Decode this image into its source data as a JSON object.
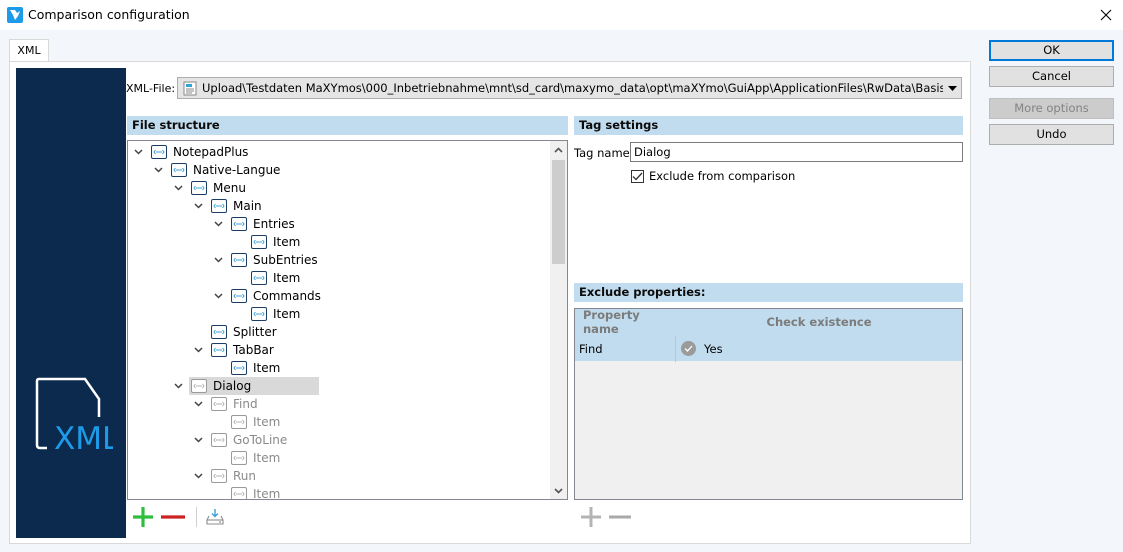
{
  "window": {
    "title": "Comparison configuration",
    "app_icon": "maxymos-app-icon",
    "close_icon": "close-icon"
  },
  "tabs": [
    {
      "label": "XML",
      "active": true
    }
  ],
  "banner": {
    "logo_text": "XML",
    "logo_icon": "xml-file-icon",
    "background": "#0c2a4e",
    "accent": "#1e9be8"
  },
  "xml_file": {
    "label": "XML-File:",
    "value": "Upload\\Testdaten MaXYmos\\000_Inbetriebnahme\\mnt\\sd_card\\maxymo_data\\opt\\maXYmo\\GuiApp\\ApplicationFiles\\RwData\\Basisversion.xml"
  },
  "file_structure": {
    "header": "File structure",
    "nodes": [
      {
        "label": "NotepadPlus",
        "level": 0,
        "expanded": true,
        "dim": false,
        "selected": false
      },
      {
        "label": "Native-Langue",
        "level": 1,
        "expanded": true,
        "dim": false,
        "selected": false
      },
      {
        "label": "Menu",
        "level": 2,
        "expanded": true,
        "dim": false,
        "selected": false
      },
      {
        "label": "Main",
        "level": 3,
        "expanded": true,
        "dim": false,
        "selected": false
      },
      {
        "label": "Entries",
        "level": 4,
        "expanded": true,
        "dim": false,
        "selected": false
      },
      {
        "label": "Item",
        "level": 5,
        "expanded": null,
        "dim": false,
        "selected": false
      },
      {
        "label": "SubEntries",
        "level": 4,
        "expanded": true,
        "dim": false,
        "selected": false
      },
      {
        "label": "Item",
        "level": 5,
        "expanded": null,
        "dim": false,
        "selected": false
      },
      {
        "label": "Commands",
        "level": 4,
        "expanded": true,
        "dim": false,
        "selected": false
      },
      {
        "label": "Item",
        "level": 5,
        "expanded": null,
        "dim": false,
        "selected": false
      },
      {
        "label": "Splitter",
        "level": 3,
        "expanded": null,
        "dim": false,
        "selected": false
      },
      {
        "label": "TabBar",
        "level": 3,
        "expanded": true,
        "dim": false,
        "selected": false
      },
      {
        "label": "Item",
        "level": 4,
        "expanded": null,
        "dim": false,
        "selected": false
      },
      {
        "label": "Dialog",
        "level": 2,
        "expanded": true,
        "dim": false,
        "selected": true
      },
      {
        "label": "Find",
        "level": 3,
        "expanded": true,
        "dim": true,
        "selected": false
      },
      {
        "label": "Item",
        "level": 4,
        "expanded": null,
        "dim": true,
        "selected": false
      },
      {
        "label": "GoToLine",
        "level": 3,
        "expanded": true,
        "dim": true,
        "selected": false
      },
      {
        "label": "Item",
        "level": 4,
        "expanded": null,
        "dim": true,
        "selected": false
      },
      {
        "label": "Run",
        "level": 3,
        "expanded": true,
        "dim": true,
        "selected": false
      },
      {
        "label": "Item",
        "level": 4,
        "expanded": null,
        "dim": true,
        "selected": false
      }
    ],
    "toolbar": {
      "add_icon": "plus-icon",
      "remove_icon": "minus-icon",
      "import_icon": "import-icon",
      "add_color": "#2ebd3c",
      "remove_color": "#cc2222"
    }
  },
  "tag_settings": {
    "header": "Tag settings",
    "tag_name_label": "Tag name:",
    "tag_name_value": "Dialog",
    "exclude_label": "Exclude from comparison",
    "exclude_checked": true
  },
  "exclude_properties": {
    "header": "Exclude properties:",
    "columns": [
      "Property name",
      "Check existence"
    ],
    "rows": [
      {
        "property": "Find",
        "check_existence": "Yes"
      }
    ]
  },
  "buttons": {
    "ok": "OK",
    "cancel": "Cancel",
    "more_options": "More options",
    "undo": "Undo"
  }
}
